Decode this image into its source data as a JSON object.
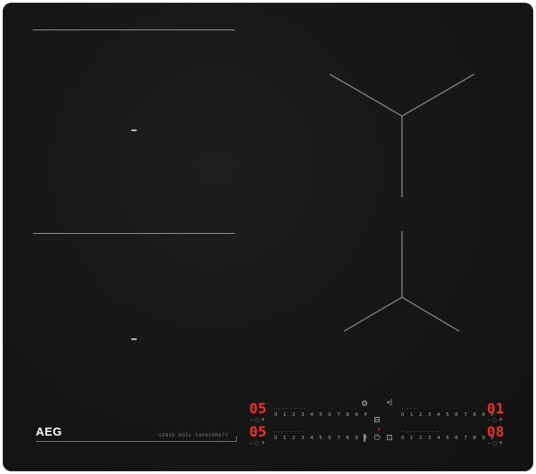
{
  "brand": {
    "logo": "AEG",
    "model": "SENSE BOIL SAPHIRMATT"
  },
  "zones": {
    "top_left_line": "bridge-zone-front",
    "bottom_left_line": "bridge-zone-rear"
  },
  "controls": {
    "top_left": {
      "display": "05",
      "level_bar": "--------",
      "scale": "0 1 2 3 4 5 6 7 8 9 P",
      "minus_timer_plus": "– ◌ +"
    },
    "bottom_left": {
      "display": "05",
      "level_bar": "--------",
      "scale": "0 1 2 3 4 5 6 7 8 9 P",
      "minus_timer_plus": "– ◌ +"
    },
    "top_right": {
      "display": "01",
      "level_bar": "----",
      "scale": "0 1 2 3 4 5 6 7 8 9 P",
      "minus_timer_plus": "– ◌ +"
    },
    "bottom_right": {
      "display": "08",
      "level_bar": "---------",
      "scale": "0 1 2 3 4 5 6 7 8 9 P",
      "minus_timer_plus": "– ◌ +"
    },
    "indicator_dot": "•",
    "icons": [
      "bridge-icon",
      "hob2hood-icon",
      "power-icon",
      "pause-icon",
      "lock-icon",
      "stopgo-icon"
    ]
  },
  "colors": {
    "glass": "#161617",
    "display_red": "#e8322b",
    "marking_gray": "#8a8a8a"
  }
}
